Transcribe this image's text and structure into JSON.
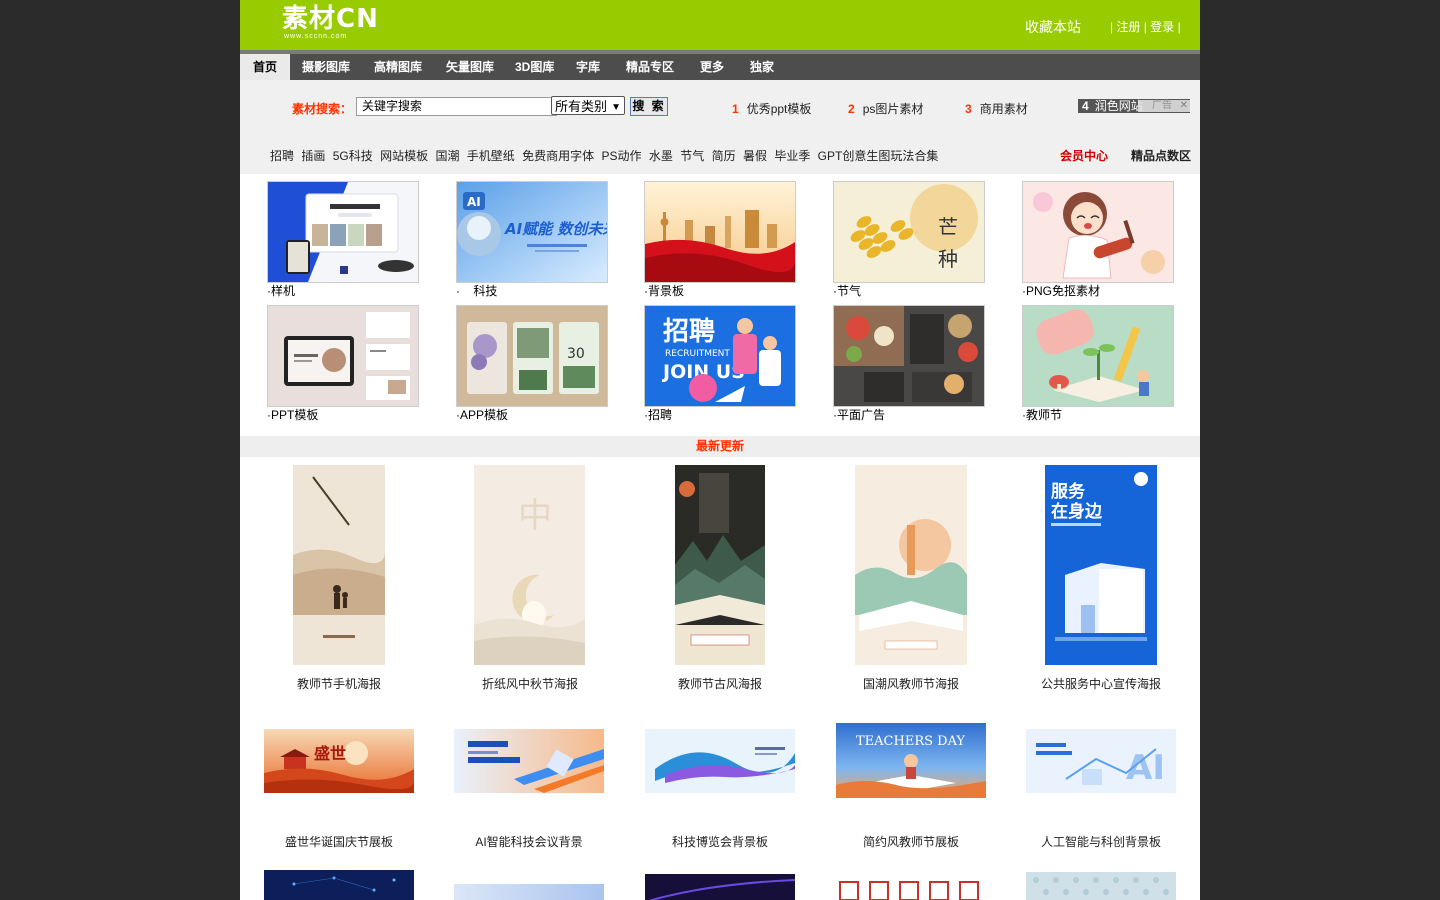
{
  "header": {
    "logo_text": "素材CN",
    "logo_sub": "www.sccnn.com",
    "bookmark_label": "收藏本站",
    "register_label": "注册",
    "login_label": "登录"
  },
  "nav": {
    "items": [
      "首页",
      "摄影图库",
      "高精图库",
      "矢量图库",
      "3D图库",
      "字库",
      "精品专区",
      "更多",
      "独家"
    ],
    "active_index": 0
  },
  "search": {
    "label": "素材搜索：",
    "input_value": "关键字搜索",
    "category_value": "所有类别",
    "button_label": "搜 索",
    "hot": [
      {
        "num": "1",
        "label": "优秀ppt模板"
      },
      {
        "num": "2",
        "label": "ps图片素材"
      },
      {
        "num": "3",
        "label": "商用素材"
      },
      {
        "num": "4",
        "label": "润色网站"
      }
    ],
    "ad_label": "广告"
  },
  "tags": {
    "items": [
      "招聘",
      "插画",
      "5G科技",
      "网站模板",
      "国潮",
      "手机壁纸",
      "免费商用字体",
      "PS动作",
      "水墨",
      "节气",
      "简历",
      "暑假",
      "毕业季",
      "GPT创意生图玩法合集"
    ],
    "member_center": "会员中心",
    "points_zone": "精品点数区"
  },
  "categories": [
    {
      "label": "·样机"
    },
    {
      "label": "·    科技"
    },
    {
      "label": "·背景板"
    },
    {
      "label": "·节气"
    },
    {
      "label": "·PNG免抠素材"
    },
    {
      "label": "·PPT模板"
    },
    {
      "label": "·APP模板"
    },
    {
      "label": "·招聘"
    },
    {
      "label": "·平面广告"
    },
    {
      "label": "·教师节"
    }
  ],
  "section_title": "最新更新",
  "posters": [
    {
      "label": "教师节手机海报"
    },
    {
      "label": "折纸风中秋节海报"
    },
    {
      "label": "教师节古风海报"
    },
    {
      "label": "国潮风教师节海报"
    },
    {
      "label": "公共服务中心宣传海报"
    }
  ],
  "boards": [
    {
      "label": "盛世华诞国庆节展板"
    },
    {
      "label": "AI智能科技会议背景"
    },
    {
      "label": "科技博览会背景板"
    },
    {
      "label": "简约风教师节展板"
    },
    {
      "label": "人工智能与科创背景板"
    }
  ],
  "thumb_text": {
    "ai_title": "AI赋能 数创未来",
    "ai_badge": "AI",
    "solar_1": "芒",
    "solar_2": "种",
    "recruit_1": "招聘",
    "recruit_2": "RECRUITMENT",
    "recruit_3": "JOIN US",
    "service_1": "服务",
    "service_2": "在身边",
    "teachers_day": "TEACHERS DAY",
    "guoqing": "盛世"
  }
}
